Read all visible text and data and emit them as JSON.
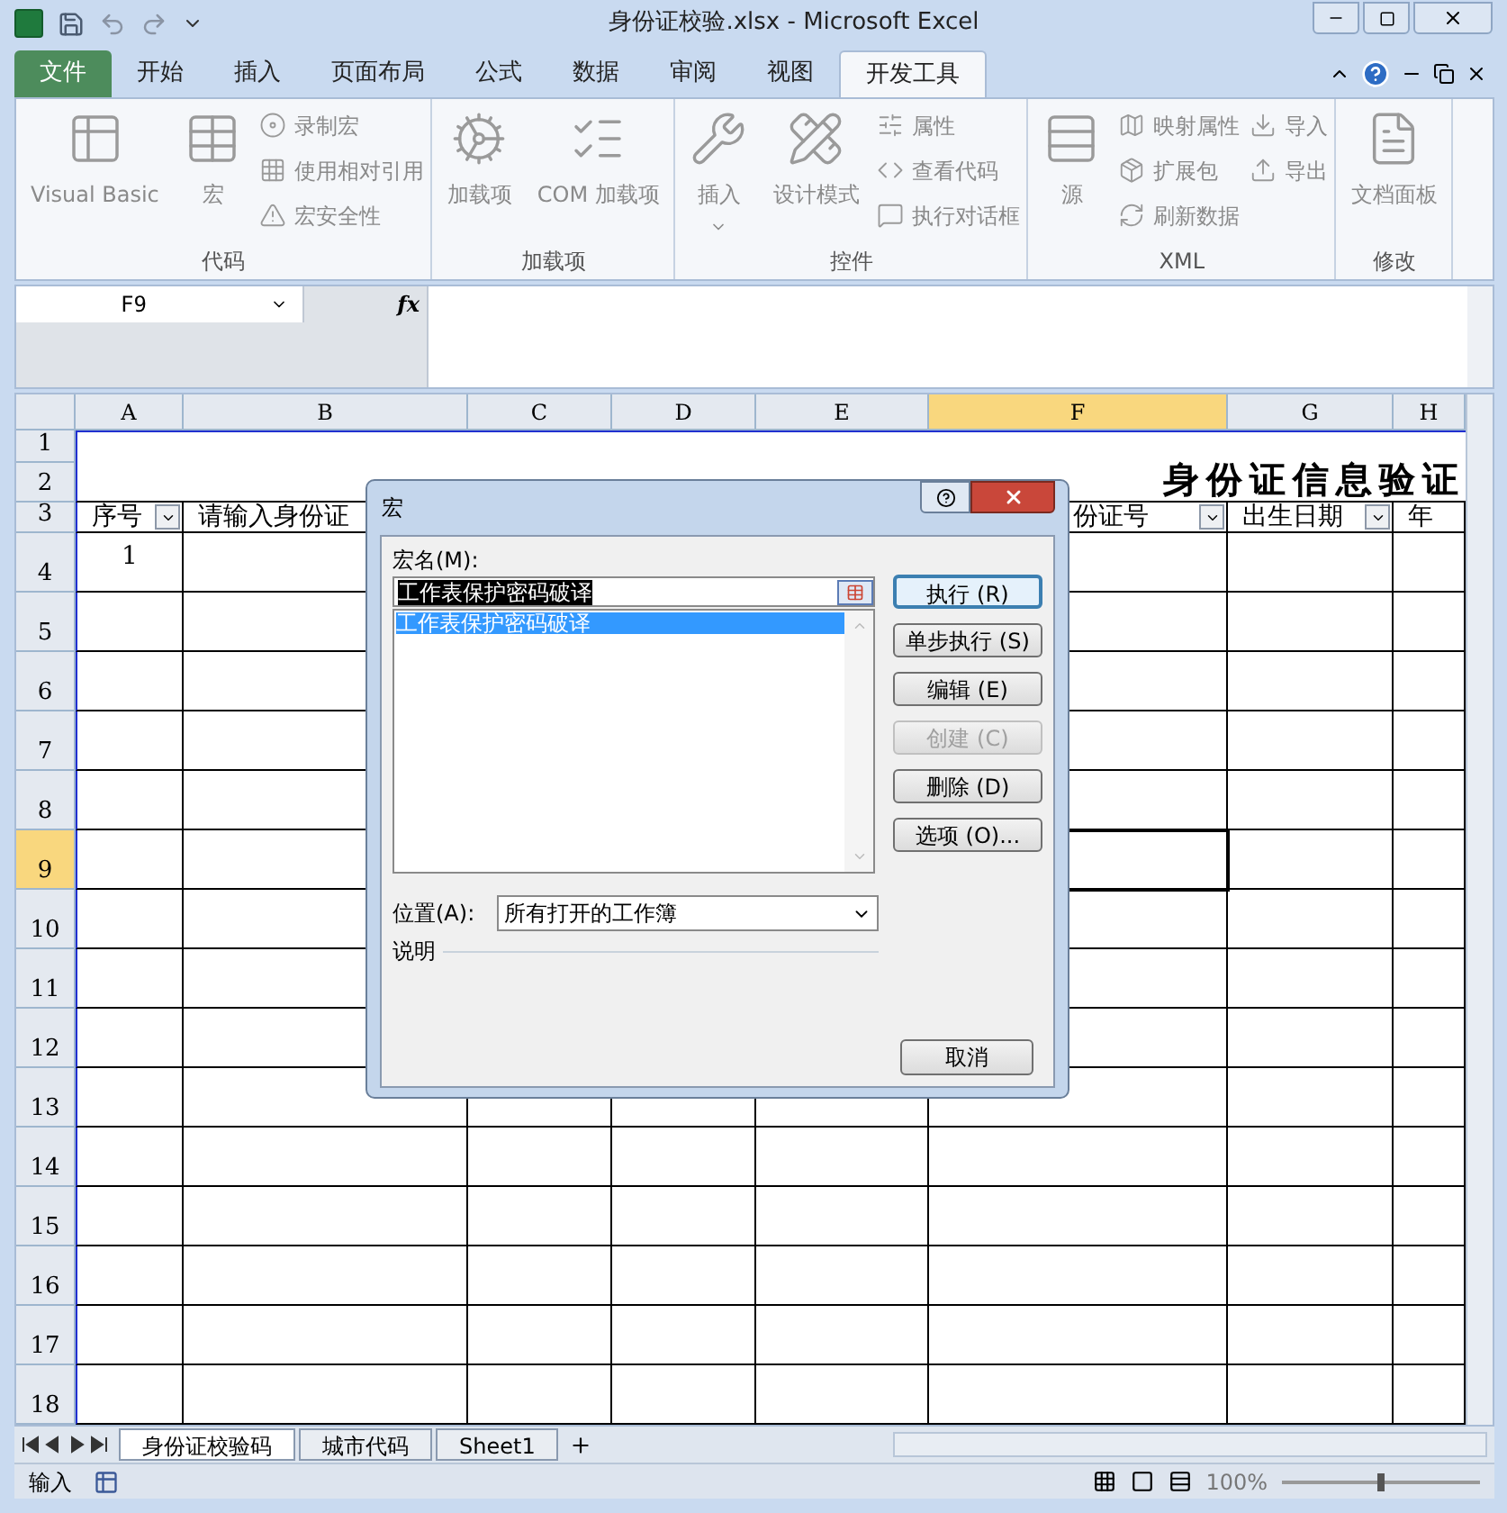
{
  "window": {
    "title": "身份证校验.xlsx - Microsoft Excel"
  },
  "ribbon": {
    "tabs": [
      {
        "label": "文件",
        "kind": "file",
        "selected": false
      },
      {
        "label": "开始",
        "kind": "tab",
        "selected": false
      },
      {
        "label": "插入",
        "kind": "tab",
        "selected": false
      },
      {
        "label": "页面布局",
        "kind": "tab",
        "selected": false
      },
      {
        "label": "公式",
        "kind": "tab",
        "selected": false
      },
      {
        "label": "数据",
        "kind": "tab",
        "selected": false
      },
      {
        "label": "审阅",
        "kind": "tab",
        "selected": false
      },
      {
        "label": "视图",
        "kind": "tab",
        "selected": false
      },
      {
        "label": "开发工具",
        "kind": "tab",
        "selected": true
      }
    ],
    "groups": [
      {
        "label": "代码",
        "columns": [
          [
            {
              "label": "Visual Basic",
              "kind": "large"
            }
          ],
          [
            {
              "label": "宏",
              "kind": "large"
            }
          ],
          [
            {
              "label": "录制宏",
              "kind": "small"
            },
            {
              "label": "使用相对引用",
              "kind": "small"
            },
            {
              "label": "宏安全性",
              "kind": "small"
            }
          ]
        ]
      },
      {
        "label": "加载项",
        "columns": [
          [
            {
              "label": "加载项",
              "kind": "large"
            }
          ],
          [
            {
              "label": "COM 加载项",
              "kind": "large"
            }
          ]
        ]
      },
      {
        "label": "控件",
        "columns": [
          [
            {
              "label": "插入",
              "kind": "menu"
            }
          ],
          [
            {
              "label": "设计模式",
              "kind": "large"
            }
          ],
          [
            {
              "label": "属性",
              "kind": "small"
            },
            {
              "label": "查看代码",
              "kind": "small"
            },
            {
              "label": "执行对话框",
              "kind": "small"
            }
          ]
        ]
      },
      {
        "label": "XML",
        "columns": [
          [
            {
              "label": "源",
              "kind": "large"
            }
          ],
          [
            {
              "label": "映射属性",
              "kind": "small"
            },
            {
              "label": "扩展包",
              "kind": "small"
            },
            {
              "label": "刷新数据",
              "kind": "small"
            }
          ],
          [
            {
              "label": "导入",
              "kind": "small"
            },
            {
              "label": "导出",
              "kind": "small"
            }
          ]
        ]
      },
      {
        "label": "修改",
        "columns": [
          [
            {
              "label": "文档面板",
              "kind": "large"
            }
          ]
        ]
      }
    ]
  },
  "formula_bar": {
    "name_box": "F9",
    "function_label": "fx"
  },
  "sheet": {
    "columns": [
      {
        "label": "A",
        "selected": false
      },
      {
        "label": "B",
        "selected": false
      },
      {
        "label": "C",
        "selected": false
      },
      {
        "label": "D",
        "selected": false
      },
      {
        "label": "E",
        "selected": false
      },
      {
        "label": "F",
        "selected": true
      },
      {
        "label": "G",
        "selected": false
      },
      {
        "label": "H",
        "selected": false
      }
    ],
    "rows": [
      {
        "label": "1",
        "selected": false
      },
      {
        "label": "2",
        "selected": false
      },
      {
        "label": "3",
        "selected": false
      },
      {
        "label": "4",
        "selected": false
      },
      {
        "label": "5",
        "selected": false
      },
      {
        "label": "6",
        "selected": false
      },
      {
        "label": "7",
        "selected": false
      },
      {
        "label": "8",
        "selected": false
      },
      {
        "label": "9",
        "selected": true
      },
      {
        "label": "10",
        "selected": false
      },
      {
        "label": "11",
        "selected": false
      },
      {
        "label": "12",
        "selected": false
      },
      {
        "label": "13",
        "selected": false
      },
      {
        "label": "14",
        "selected": false
      },
      {
        "label": "15",
        "selected": false
      },
      {
        "label": "16",
        "selected": false
      },
      {
        "label": "17",
        "selected": false
      },
      {
        "label": "18",
        "selected": false
      }
    ],
    "title": "身份证信息验证",
    "header_cells": [
      {
        "text": "序号",
        "filter": true
      },
      {
        "text": "请输入身份证",
        "filter": false
      },
      null,
      null,
      null,
      {
        "text": "份证号",
        "filter": true
      },
      {
        "text": "出生日期",
        "filter": true
      },
      {
        "text": "年",
        "filter": false
      }
    ],
    "data": [
      [
        "1"
      ]
    ]
  },
  "sheet_tabs": [
    {
      "label": "身份证校验码",
      "selected": true
    },
    {
      "label": "城市代码",
      "selected": false
    },
    {
      "label": "Sheet1",
      "selected": false
    }
  ],
  "status_bar": {
    "mode": "输入",
    "zoom": "100%",
    "zoom_slider": {
      "level": 0.5
    }
  },
  "dialog": {
    "title": "宏",
    "name_label": "宏名(M):",
    "name_value": "工作表保护密码破译",
    "list": [
      {
        "label": "工作表保护密码破译",
        "selected": true
      }
    ],
    "buttons": [
      {
        "label": "执行 (R)",
        "default": true,
        "disabled": false
      },
      {
        "label": "单步执行 (S)",
        "default": false,
        "disabled": false
      },
      {
        "label": "编辑 (E)",
        "default": false,
        "disabled": false
      },
      {
        "label": "创建 (C)",
        "default": false,
        "disabled": true
      },
      {
        "label": "删除 (D)",
        "default": false,
        "disabled": false
      },
      {
        "label": "选项 (O)...",
        "default": false,
        "disabled": false
      }
    ],
    "location_label": "位置(A):",
    "location_value": "所有打开的工作簿",
    "description_label": "说明",
    "cancel": "取消"
  }
}
